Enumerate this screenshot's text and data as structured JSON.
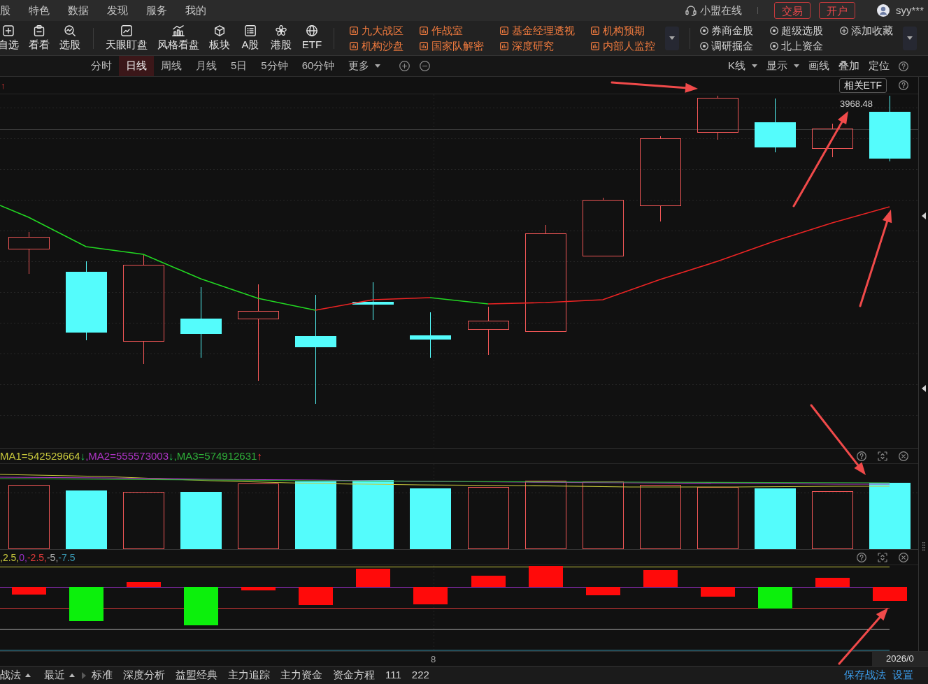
{
  "menu_bar": {
    "items": [
      "股",
      "特色",
      "数据",
      "发现",
      "服务",
      "我的"
    ],
    "service_label": "小盟在线",
    "buttons": [
      "交易",
      "开户"
    ],
    "user_name": "syy***"
  },
  "toolbar": {
    "tool_groups": [
      [
        "自选",
        "看看",
        "选股"
      ],
      [
        "天眼盯盘",
        "风格看盘",
        "板块",
        "A股",
        "港股",
        "ETF"
      ]
    ],
    "feature_links": [
      [
        "九大战区",
        "机构沙盘"
      ],
      [
        "作战室",
        "国家队解密"
      ],
      [
        "基金经理透视",
        "深度研究"
      ],
      [
        "机构预期",
        "内部人监控"
      ]
    ],
    "shortcuts": [
      [
        {
          "label": "券商金股",
          "kind": "target"
        },
        {
          "label": "调研掘金",
          "kind": "target"
        }
      ],
      [
        {
          "label": "超级选股",
          "kind": "target"
        },
        {
          "label": "北上资金",
          "kind": "target"
        }
      ],
      [
        {
          "label": "添加收藏",
          "kind": "add"
        }
      ]
    ]
  },
  "period_bar": {
    "periods": [
      {
        "label": "分时",
        "selected": false,
        "dropdown": false
      },
      {
        "label": "日线",
        "selected": true,
        "dropdown": false
      },
      {
        "label": "周线",
        "selected": false,
        "dropdown": false
      },
      {
        "label": "月线",
        "selected": false,
        "dropdown": false
      },
      {
        "label": "5日",
        "selected": false,
        "dropdown": false
      },
      {
        "label": "5分钟",
        "selected": false,
        "dropdown": false
      },
      {
        "label": "60分钟",
        "selected": false,
        "dropdown": false
      },
      {
        "label": "更多",
        "selected": false,
        "dropdown": true
      }
    ],
    "tools": [
      {
        "label": "K线",
        "dropdown": true
      },
      {
        "label": "显示",
        "dropdown": true
      },
      {
        "label": "画线",
        "dropdown": false
      },
      {
        "label": "叠加",
        "dropdown": false
      },
      {
        "label": "定位",
        "dropdown": false
      }
    ]
  },
  "chart": {
    "trend_mark": "↑",
    "related_button": "相关ETF",
    "price_label": "3968.48"
  },
  "volume_panel": {
    "legend": [
      {
        "label": "MA1=542529664",
        "color": "#c8c83c",
        "arrow": "↓",
        "rising": false
      },
      {
        "label": ",MA2=555573003",
        "color": "#b035c8",
        "arrow": "↓",
        "rising": false
      },
      {
        "label": ",MA3=574912631",
        "color": "#2fb03a",
        "arrow": "↑",
        "rising": true
      }
    ]
  },
  "macd_panel": {
    "legend": [
      {
        "label": ",2.5,",
        "color": "#c8c83c"
      },
      {
        "label": "0,",
        "color": "#9a30c8"
      },
      {
        "label": "-2.5,",
        "color": "#e03a3a"
      },
      {
        "label": "-5,",
        "color": "#b0b0b0"
      },
      {
        "label": "-7.5",
        "color": "#3a9ab4"
      }
    ]
  },
  "x_axis": {
    "tick": "8",
    "date": "2026/0"
  },
  "bottom_bar": {
    "menus": [
      "战法",
      "最近"
    ],
    "tabs": [
      "标准",
      "深度分析",
      "益盟经典",
      "主力追踪",
      "主力资金",
      "资金方程",
      "111",
      "222"
    ],
    "actions": [
      "保存战法",
      "设置"
    ]
  }
}
